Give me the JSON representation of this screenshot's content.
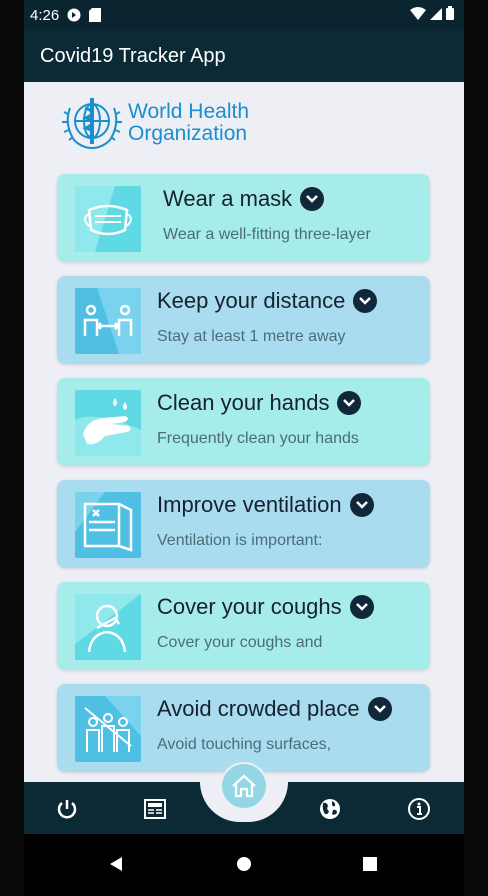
{
  "status": {
    "time": "4:26"
  },
  "appbar": {
    "title": "Covid19 Tracker App"
  },
  "logo": {
    "line1": "World Health",
    "line2": "Organization"
  },
  "cards": [
    {
      "title": "Wear a mask",
      "subtitle": "Wear a well-fitting three-layer",
      "color": "#a6ecea"
    },
    {
      "title": "Keep your distance",
      "subtitle": "Stay at least 1 metre away",
      "color": "#a9dcef"
    },
    {
      "title": "Clean your hands",
      "subtitle": "Frequently clean your hands",
      "color": "#a6ecea"
    },
    {
      "title": "Improve ventilation",
      "subtitle": "Ventilation is important:",
      "color": "#a9dcef"
    },
    {
      "title": "Cover your coughs",
      "subtitle": "Cover your coughs and",
      "color": "#a6ecea"
    },
    {
      "title": "Avoid crowded place",
      "subtitle": "Avoid touching surfaces,",
      "color": "#a9dcef"
    }
  ],
  "bottom_nav": {
    "items": [
      "power-icon",
      "news-icon",
      "home-icon",
      "globe-icon",
      "info-icon"
    ]
  },
  "colors": {
    "bar": "#0b2a36",
    "accent": "#1a8fce",
    "background": "#eeeef5"
  }
}
